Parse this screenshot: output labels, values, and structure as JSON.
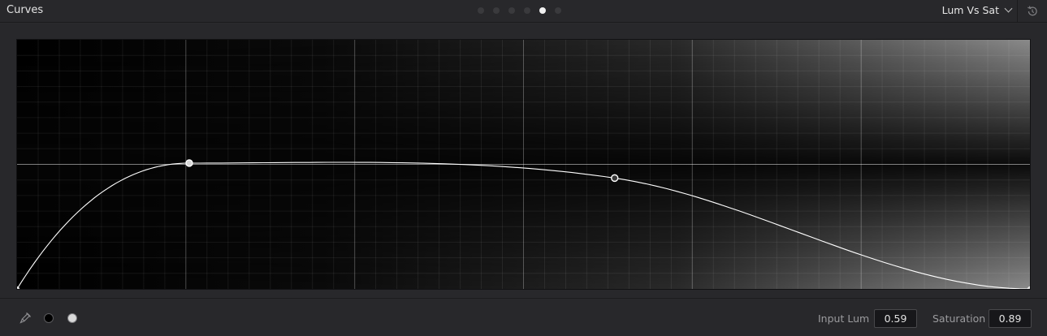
{
  "header": {
    "title": "Curves",
    "page_dots": {
      "count": 6,
      "active_index": 4
    },
    "mode_label": "Lum Vs Sat",
    "reset_icon": "reset-icon"
  },
  "graph": {
    "x_range": [
      0,
      1
    ],
    "y_range": [
      0,
      2
    ],
    "control_points": [
      {
        "x": 0.0,
        "y": 0.0
      },
      {
        "x": 0.17,
        "y": 1.01
      },
      {
        "x": 0.59,
        "y": 0.89
      },
      {
        "x": 1.0,
        "y": 0.0
      }
    ],
    "curve_color": "#ffffff"
  },
  "footer": {
    "tools": [
      "color-picker-icon",
      "black-swatch",
      "white-swatch"
    ],
    "input_label": "Input Lum",
    "input_value": "0.59",
    "output_label": "Saturation",
    "output_value": "0.89"
  }
}
